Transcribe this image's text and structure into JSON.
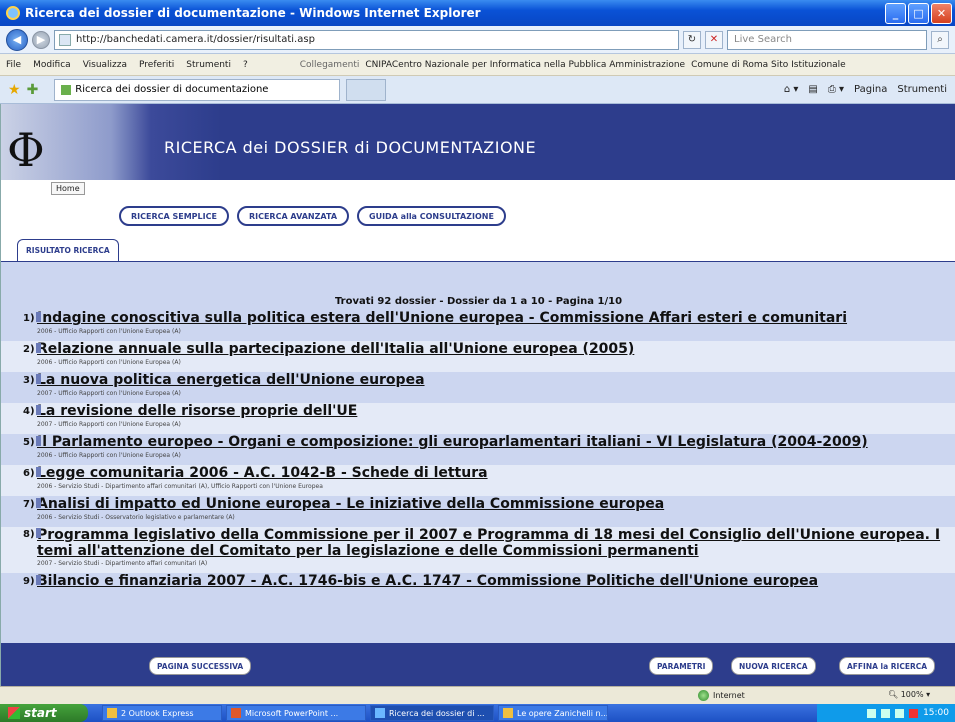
{
  "window": {
    "title": "Ricerca dei dossier di documentazione - Windows Internet Explorer"
  },
  "address_bar": {
    "url": "http://banchedati.camera.it/dossier/risultati.asp",
    "search_placeholder": "Live Search"
  },
  "menu": {
    "items": [
      "File",
      "Modifica",
      "Visualizza",
      "Preferiti",
      "Strumenti",
      "?"
    ],
    "links_label": "Collegamenti",
    "links": [
      "CNIPACentro Nazionale per Informatica nella Pubblica Amministrazione",
      "Comune di Roma Sito Istituzionale"
    ]
  },
  "tabbar": {
    "tab_title": "Ricerca dei dossier di documentazione",
    "commands": [
      "Pagina",
      "Strumenti"
    ]
  },
  "page": {
    "banner_title": "RICERCA dei DOSSIER di DOCUMENTAZIONE",
    "home": "Home",
    "buttons": [
      "RICERCA SEMPLICE",
      "RICERCA AVANZATA",
      "GUIDA alla CONSULTAZIONE"
    ],
    "result_tab": "RISULTATO RICERCA",
    "summary": "Trovati 92 dossier - Dossier da 1 a 10 - Pagina 1/10",
    "results": [
      {
        "num": "1)",
        "title": "Indagine conoscitiva sulla politica estera dell'Unione europea - Commissione Affari esteri e comunitari",
        "meta": "2006 - Ufficio Rapporti con l'Unione Europea (A)"
      },
      {
        "num": "2)",
        "title": "Relazione annuale sulla partecipazione dell'Italia all'Unione europea (2005)",
        "meta": "2006 - Ufficio Rapporti con l'Unione Europea (A)"
      },
      {
        "num": "3)",
        "title": "La nuova politica energetica dell'Unione europea",
        "meta": "2007 - Ufficio Rapporti con l'Unione Europea (A)"
      },
      {
        "num": "4)",
        "title": "La revisione delle risorse proprie dell'UE",
        "meta": "2007 - Ufficio Rapporti con l'Unione Europea (A)"
      },
      {
        "num": "5)",
        "title": "Il Parlamento europeo - Organi e composizione: gli europarlamentari italiani - VI Legislatura (2004-2009)",
        "meta": "2006 - Ufficio Rapporti con l'Unione Europea (A)"
      },
      {
        "num": "6)",
        "title": "Legge comunitaria 2006 - A.C. 1042-B - Schede di lettura",
        "meta": "2006 - Servizio Studi - Dipartimento affari comunitari (A), Ufficio Rapporti con l'Unione Europea"
      },
      {
        "num": "7)",
        "title": "Analisi di impatto ed Unione europea - Le iniziative della Commissione europea",
        "meta": "2006 - Servizio Studi - Osservatorio legislativo e parlamentare (A)"
      },
      {
        "num": "8)",
        "title": "Programma legislativo della Commissione per il 2007 e Programma di 18 mesi del Consiglio dell'Unione europea. I temi all'attenzione del Comitato per la legislazione e delle Commissioni permanenti",
        "meta": "2007 - Servizio Studi - Dipartimento affari comunitari (A)"
      },
      {
        "num": "9)",
        "title": "Bilancio e finanziaria 2007 - A.C. 1746-bis e A.C. 1747 - Commissione Politiche dell'Unione europea",
        "meta": ""
      }
    ],
    "bottom_buttons": {
      "next": "PAGINA SUCCESSIVA",
      "params": "PARAMETRI",
      "new_search": "NUOVA RICERCA",
      "refine": "AFFINA la RICERCA"
    }
  },
  "statusbar": {
    "zone": "Internet",
    "zoom": "100%"
  },
  "taskbar": {
    "start": "start",
    "tasks": [
      "2 Outlook Express",
      "Microsoft PowerPoint ...",
      "Ricerca dei dossier di ...",
      "Le opere Zanichelli n..."
    ],
    "clock": "15:00"
  }
}
